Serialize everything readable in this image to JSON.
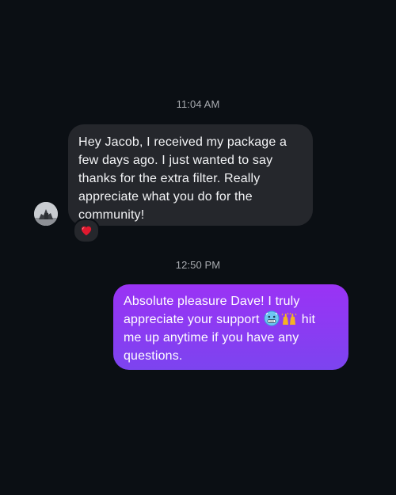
{
  "conversation": {
    "timestamps": [
      "11:04 AM",
      "12:50 PM"
    ],
    "incoming_message": {
      "lines": [
        "Hey Jacob, I received my package a",
        "few days ago. I just wanted to say",
        "thanks for the extra filter. Really",
        "appreciate what you do for the",
        "community!"
      ],
      "reaction_icon": "red-heart-icon",
      "bubble_color": "#25272c"
    },
    "outgoing_message": {
      "line1": "Absolute pleasure Dave! I truly",
      "line2_before": "appreciate your support",
      "line2_after": "hit",
      "line3": "me up anytime if you have any",
      "line4": "questions.",
      "emoji_icons": [
        "cold-face-icon",
        "raising-hands-icon"
      ],
      "bubble_color": "#8a3cf2"
    }
  },
  "colors": {
    "background": "#0b0f14",
    "timestamp_text": "#a8abb0",
    "heart": "#e0192f"
  }
}
